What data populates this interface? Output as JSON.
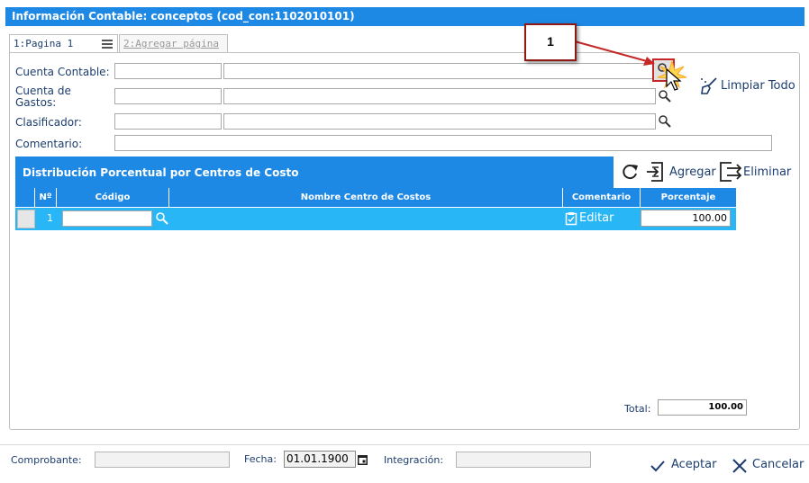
{
  "window": {
    "title": "Información Contable: conceptos (cod_con:1102010101)"
  },
  "tabs": [
    {
      "label": "1:Pagina 1"
    },
    {
      "label": "2:Agregar página"
    }
  ],
  "form": {
    "cuenta_contable_label": "Cuenta Contable:",
    "cuenta_gastos_label_1": "Cuenta de",
    "cuenta_gastos_label_2": "Gastos:",
    "clasificador_label": "Clasificador:",
    "comentario_label": "Comentario:",
    "limpiar_label": "Limpiar Todo"
  },
  "distribution": {
    "title": "Distribución Porcentual por Centros de Costo",
    "agregar_label": "Agregar",
    "eliminar_label": "Eliminar",
    "columns": [
      "Nº",
      "Código",
      "Nombre Centro de Costos",
      "Comentario",
      "Porcentaje"
    ],
    "rows": [
      {
        "n": "1",
        "codigo": "",
        "nombre": "",
        "comentario": "Editar",
        "porcentaje": "100.00"
      }
    ],
    "total_label": "Total:",
    "total_value": "100.00"
  },
  "footer": {
    "comprobante_label": "Comprobante:",
    "fecha_label": "Fecha:",
    "fecha_value": "01.01.1900",
    "integracion_label": "Integración:",
    "aceptar_label": "Aceptar",
    "cancelar_label": "Cancelar"
  },
  "annotation": {
    "callout_number": "1"
  },
  "colors": {
    "header_blue": "#1e88e5",
    "row_blue": "#29b6f6",
    "callout_border": "#8e1a14",
    "arrow": "#c62828"
  }
}
